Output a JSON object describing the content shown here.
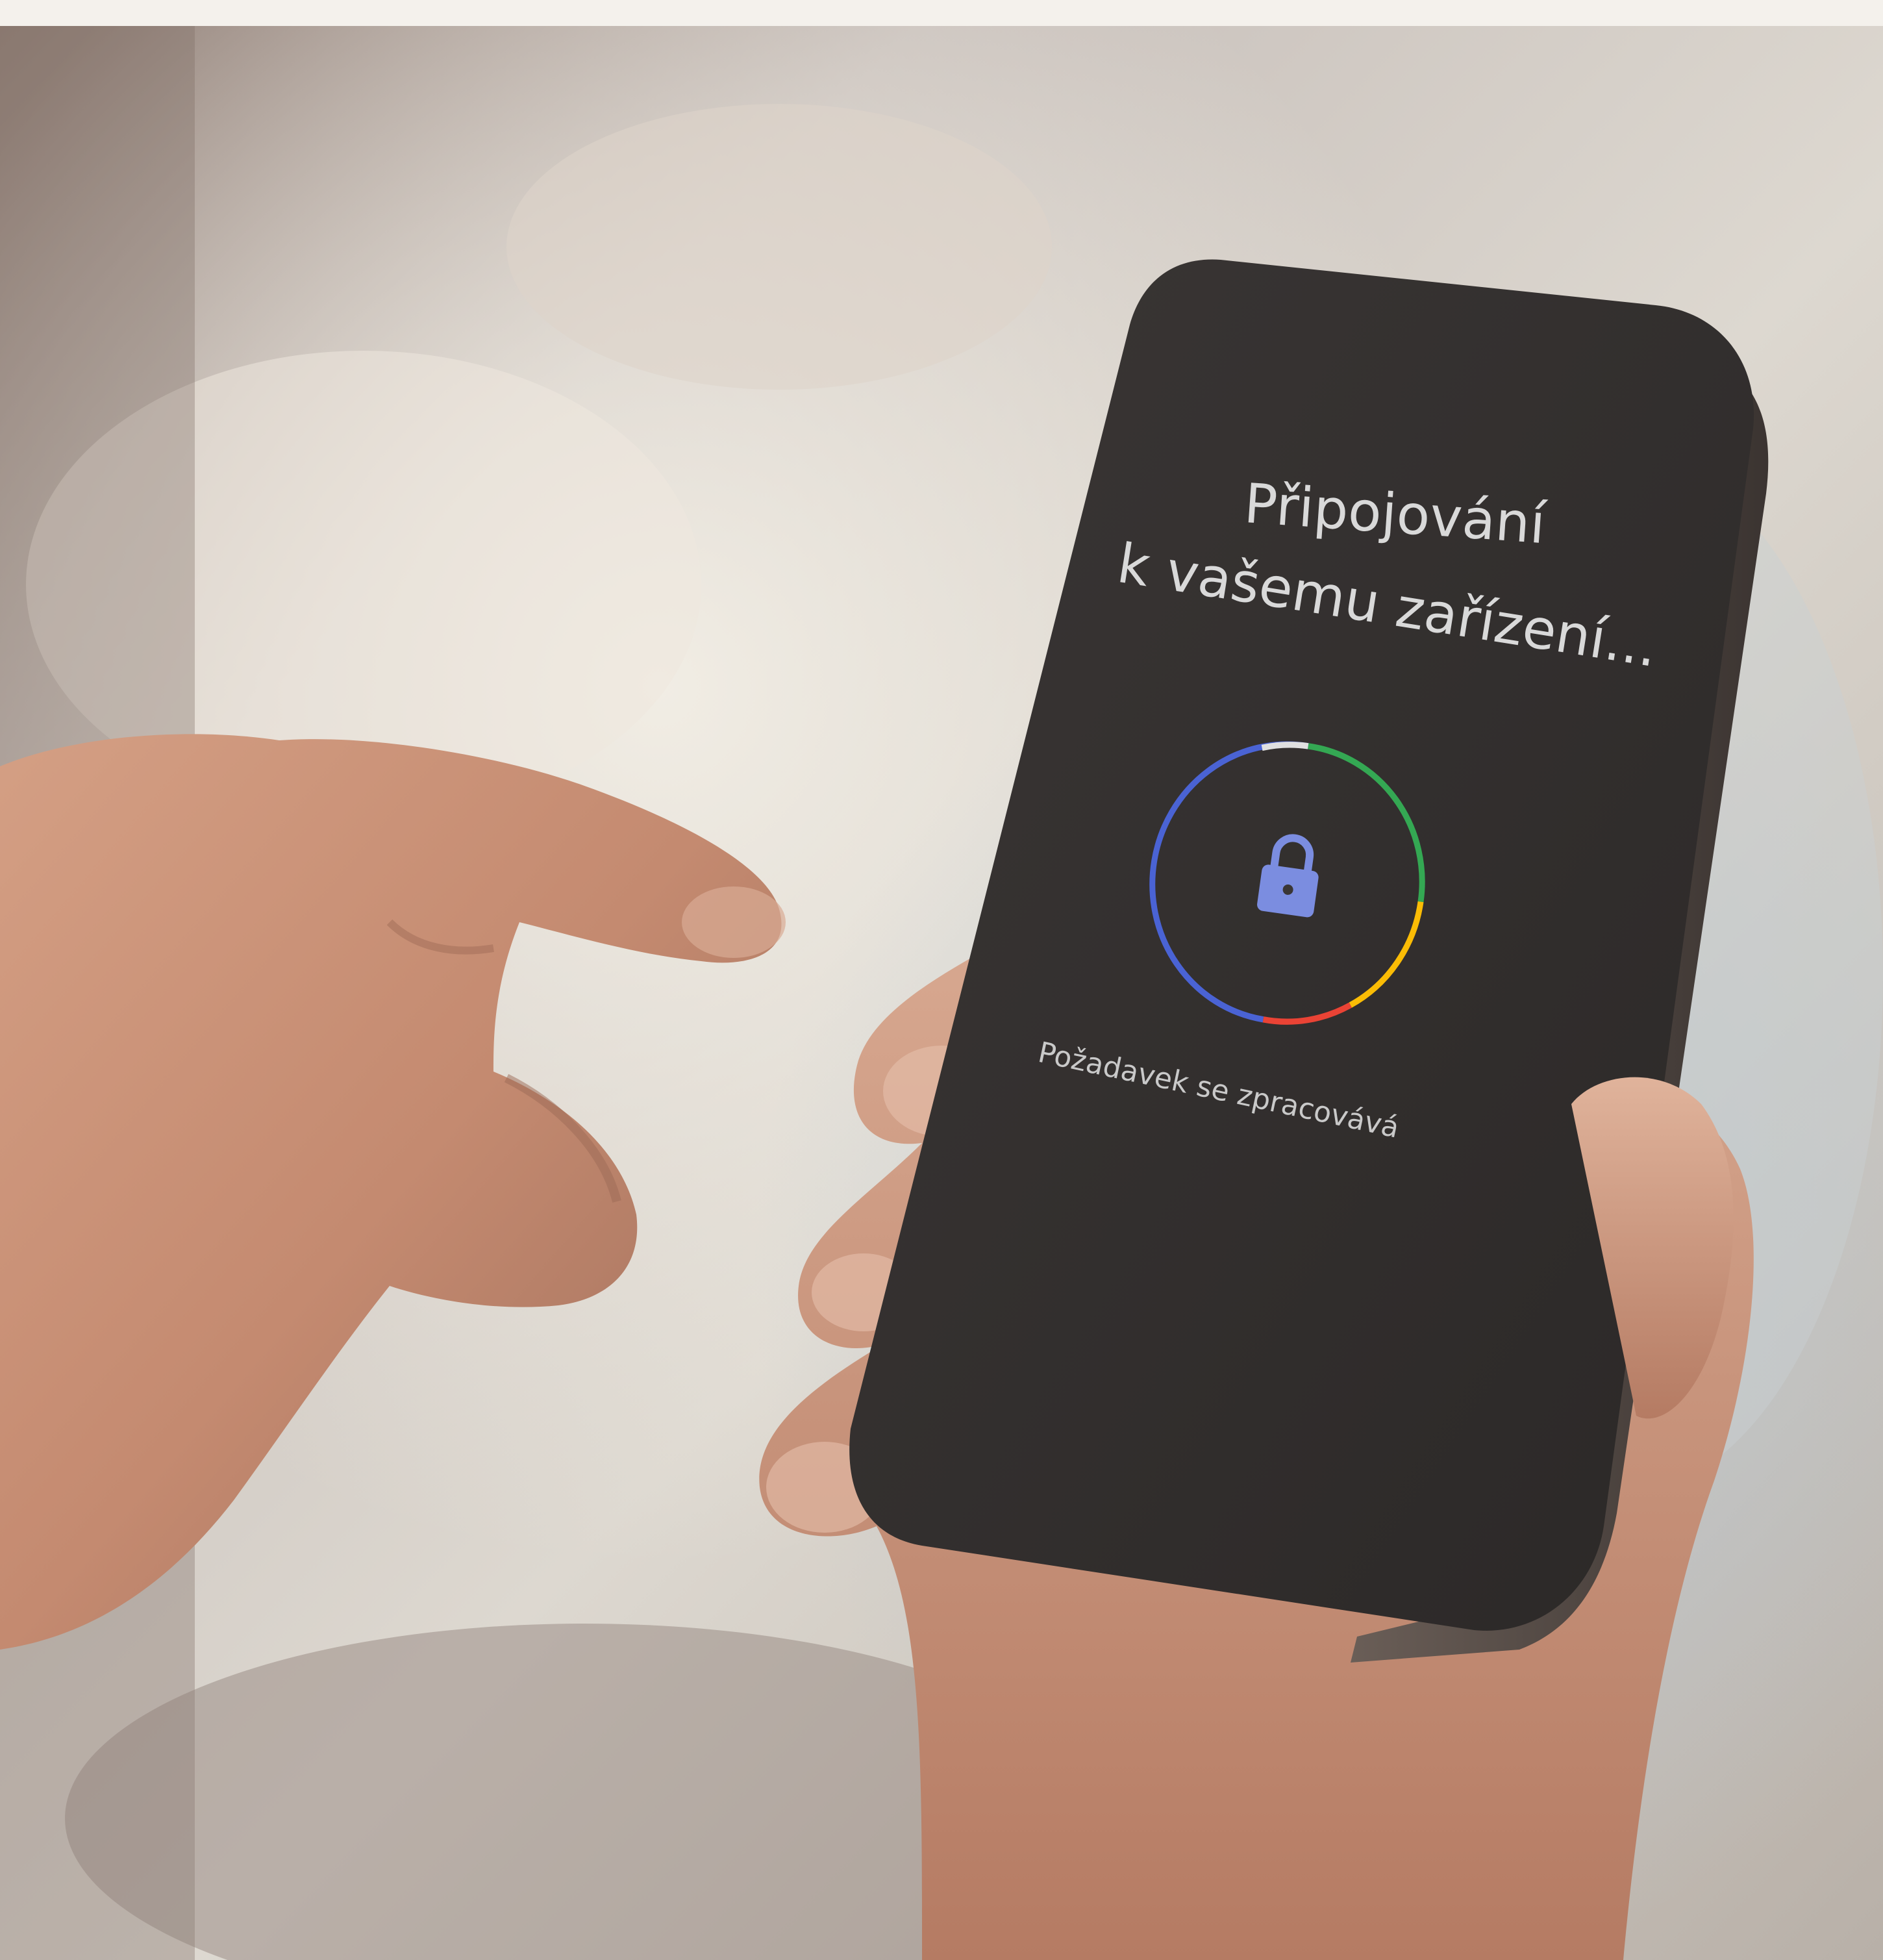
{
  "phone_screen": {
    "title_line_1": "Připojování",
    "title_line_2": "k vašemu zařízení...",
    "status_text": "Požadavek se zpracovává",
    "indicator_icon": "lock-icon",
    "ring_colors": [
      "#4285f4",
      "#34a853",
      "#fbbc05",
      "#ea4335",
      "#e0e0e0"
    ],
    "accent_color": "#7b8de0"
  }
}
